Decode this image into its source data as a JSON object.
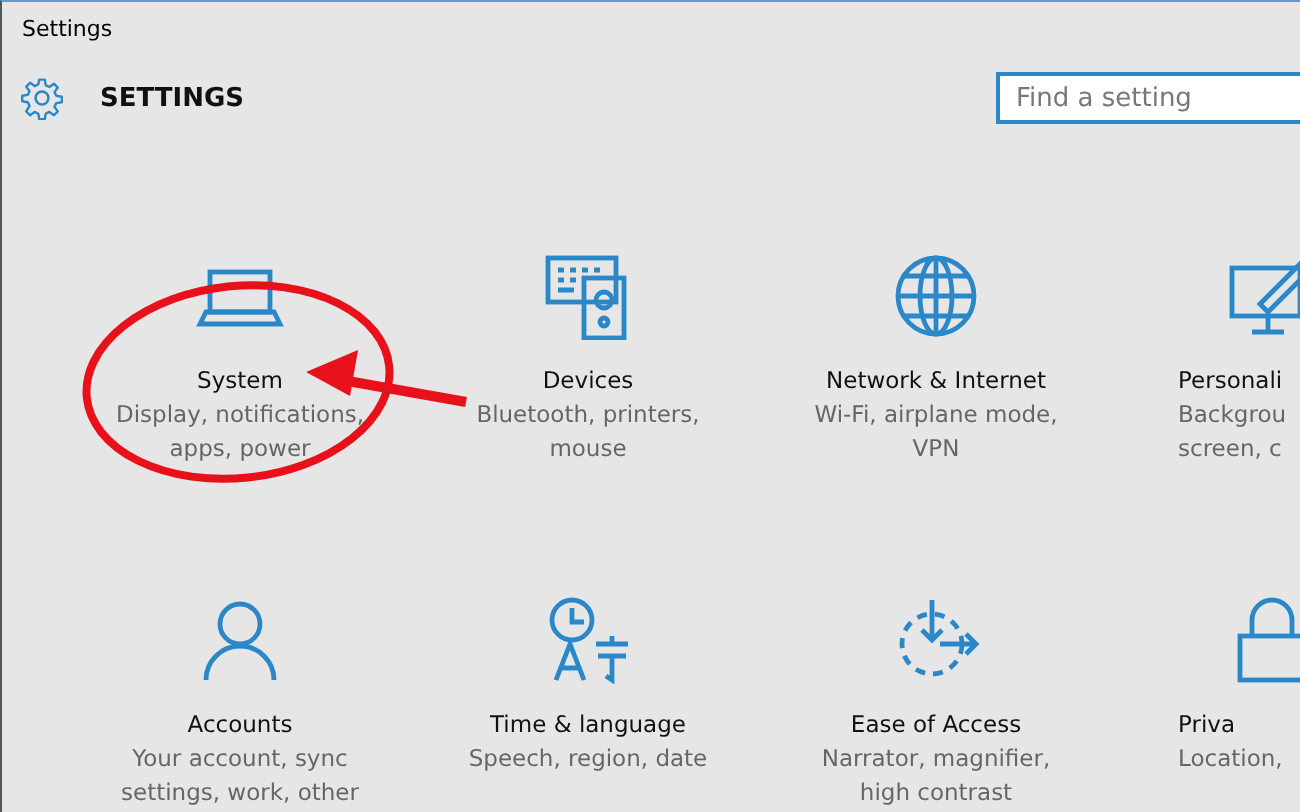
{
  "window": {
    "title": "Settings"
  },
  "header": {
    "title": "SETTINGS"
  },
  "search": {
    "placeholder": "Find a setting"
  },
  "tiles": [
    {
      "title": "System",
      "description": "Display, notifications,\napps, power"
    },
    {
      "title": "Devices",
      "description": "Bluetooth, printers,\nmouse"
    },
    {
      "title": "Network & Internet",
      "description": "Wi-Fi, airplane mode,\nVPN"
    },
    {
      "title": "Personali",
      "description": "Backgrou\nscreen, c"
    },
    {
      "title": "Accounts",
      "description": "Your account, sync\nsettings, work, other"
    },
    {
      "title": "Time & language",
      "description": "Speech, region, date"
    },
    {
      "title": "Ease of Access",
      "description": "Narrator, magnifier,\nhigh contrast"
    },
    {
      "title": "Priva",
      "description": "Location,"
    }
  ]
}
